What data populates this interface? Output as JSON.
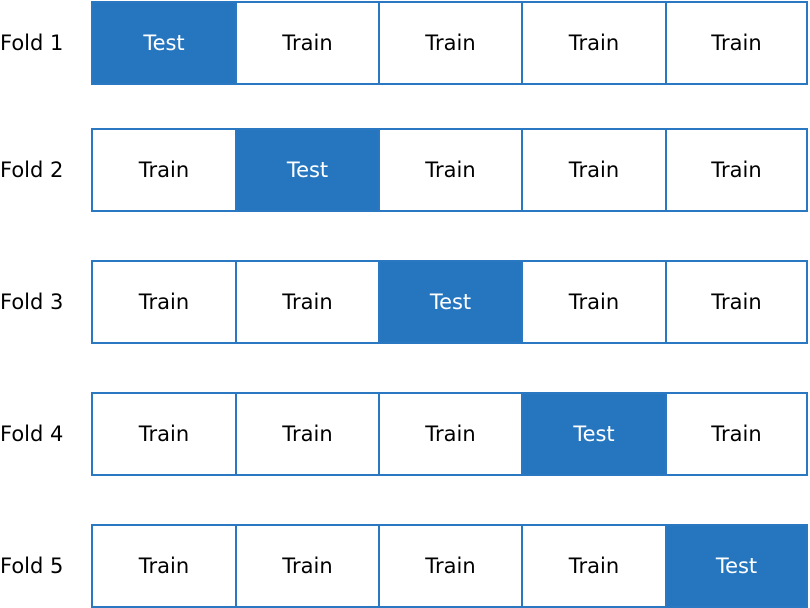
{
  "colors": {
    "test_fill": "#2575bf",
    "border": "#2a78c1",
    "train_fill": "#ffffff"
  },
  "folds": [
    {
      "label": "Fold 1",
      "cells": [
        "Test",
        "Train",
        "Train",
        "Train",
        "Train"
      ]
    },
    {
      "label": "Fold 2",
      "cells": [
        "Train",
        "Test",
        "Train",
        "Train",
        "Train"
      ]
    },
    {
      "label": "Fold 3",
      "cells": [
        "Train",
        "Train",
        "Test",
        "Train",
        "Train"
      ]
    },
    {
      "label": "Fold 4",
      "cells": [
        "Train",
        "Train",
        "Train",
        "Test",
        "Train"
      ]
    },
    {
      "label": "Fold 5",
      "cells": [
        "Train",
        "Train",
        "Train",
        "Train",
        "Test"
      ]
    }
  ]
}
